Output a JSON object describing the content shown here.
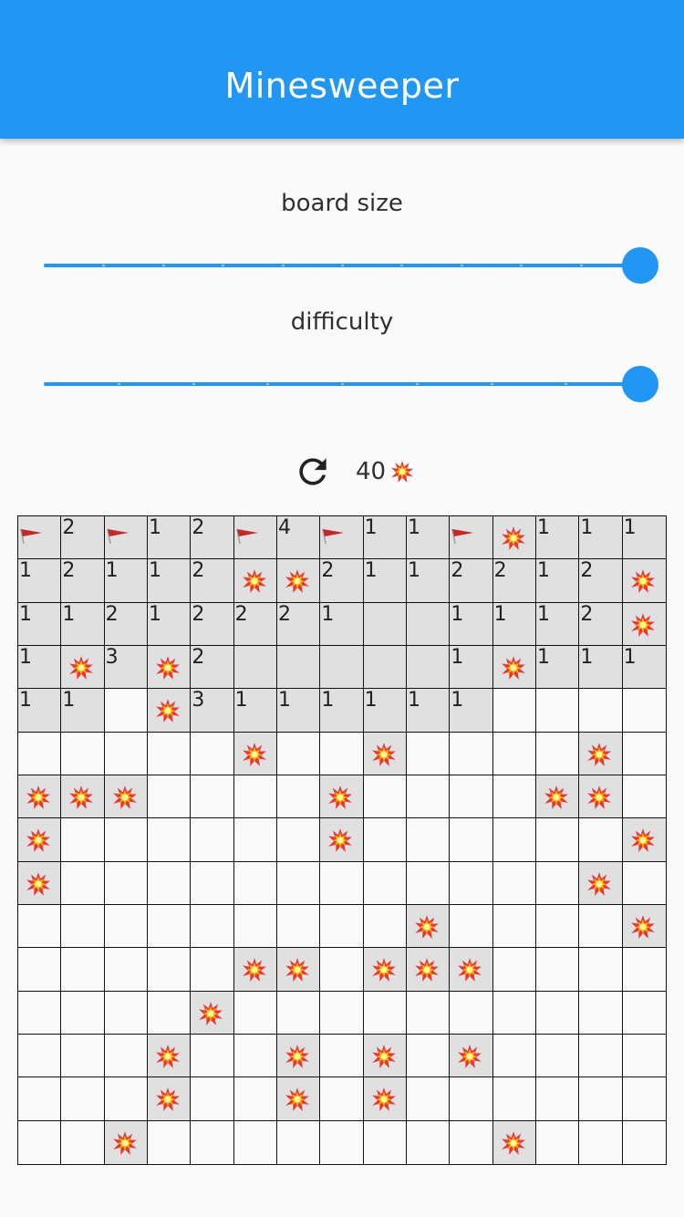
{
  "app_bar": {
    "title": "Minesweeper"
  },
  "board_size": {
    "label": "board size",
    "value": 1.0,
    "divisions": 10
  },
  "difficulty": {
    "label": "difficulty",
    "value": 1.0,
    "divisions": 8
  },
  "controls": {
    "refresh_icon": "refresh-icon",
    "mine_count": "40",
    "mine_icon": "explosion-icon"
  },
  "board": {
    "rows": 15,
    "cols": 15,
    "cells": [
      [
        "F",
        "2",
        "F",
        "1",
        "2",
        "F",
        "4",
        "F",
        "1",
        "1",
        "F",
        "M",
        "1",
        "1",
        "1"
      ],
      [
        "1",
        "2",
        "1",
        "1",
        "2",
        "M",
        "M",
        "2",
        "1",
        "1",
        "2",
        "2",
        "1",
        "2",
        "M"
      ],
      [
        "1",
        "1",
        "2",
        "1",
        "2",
        "2",
        "2",
        "1",
        "0",
        "0",
        "1",
        "1",
        "1",
        "2",
        "M"
      ],
      [
        "1",
        "M",
        "3",
        "M",
        "2",
        "0",
        "0",
        "0",
        "0",
        "0",
        "1",
        "M",
        "1",
        "1",
        "1"
      ],
      [
        "1",
        "1",
        "",
        "M",
        "3",
        "1",
        "1",
        "1",
        "1",
        "1",
        "1",
        "",
        "",
        "",
        ""
      ],
      [
        "",
        "",
        "",
        "",
        "",
        "M",
        "",
        "",
        "M",
        "",
        "",
        "",
        "",
        "M",
        ""
      ],
      [
        "M",
        "M",
        "M",
        "",
        "",
        "",
        "",
        "M",
        "",
        "",
        "",
        "",
        "M",
        "M",
        ""
      ],
      [
        "M",
        "",
        "",
        "",
        "",
        "",
        "",
        "M",
        "",
        "",
        "",
        "",
        "",
        "",
        "M"
      ],
      [
        "M",
        "",
        "",
        "",
        "",
        "",
        "",
        "",
        "",
        "",
        "",
        "",
        "",
        "M",
        ""
      ],
      [
        "",
        "",
        "",
        "",
        "",
        "",
        "",
        "",
        "",
        "M",
        "",
        "",
        "",
        "",
        "M"
      ],
      [
        "",
        "",
        "",
        "",
        "",
        "M",
        "M",
        "",
        "M",
        "M",
        "M",
        "",
        "",
        "",
        ""
      ],
      [
        "",
        "",
        "",
        "",
        "M",
        "",
        "",
        "",
        "",
        "",
        "",
        "",
        "",
        "",
        ""
      ],
      [
        "",
        "",
        "",
        "M",
        "",
        "",
        "M",
        "",
        "M",
        "",
        "M",
        "",
        "",
        "",
        ""
      ],
      [
        "",
        "",
        "",
        "M",
        "",
        "",
        "M",
        "",
        "M",
        "",
        "",
        "",
        "",
        "",
        ""
      ],
      [
        "",
        "",
        "M",
        "",
        "",
        "",
        "",
        "",
        "",
        "",
        "",
        "M",
        "",
        "",
        ""
      ]
    ]
  },
  "colors": {
    "primary": "#2196f3",
    "revealed": "#e0e0e0",
    "unrevealed": "#fafafa",
    "grid": "#111111"
  }
}
